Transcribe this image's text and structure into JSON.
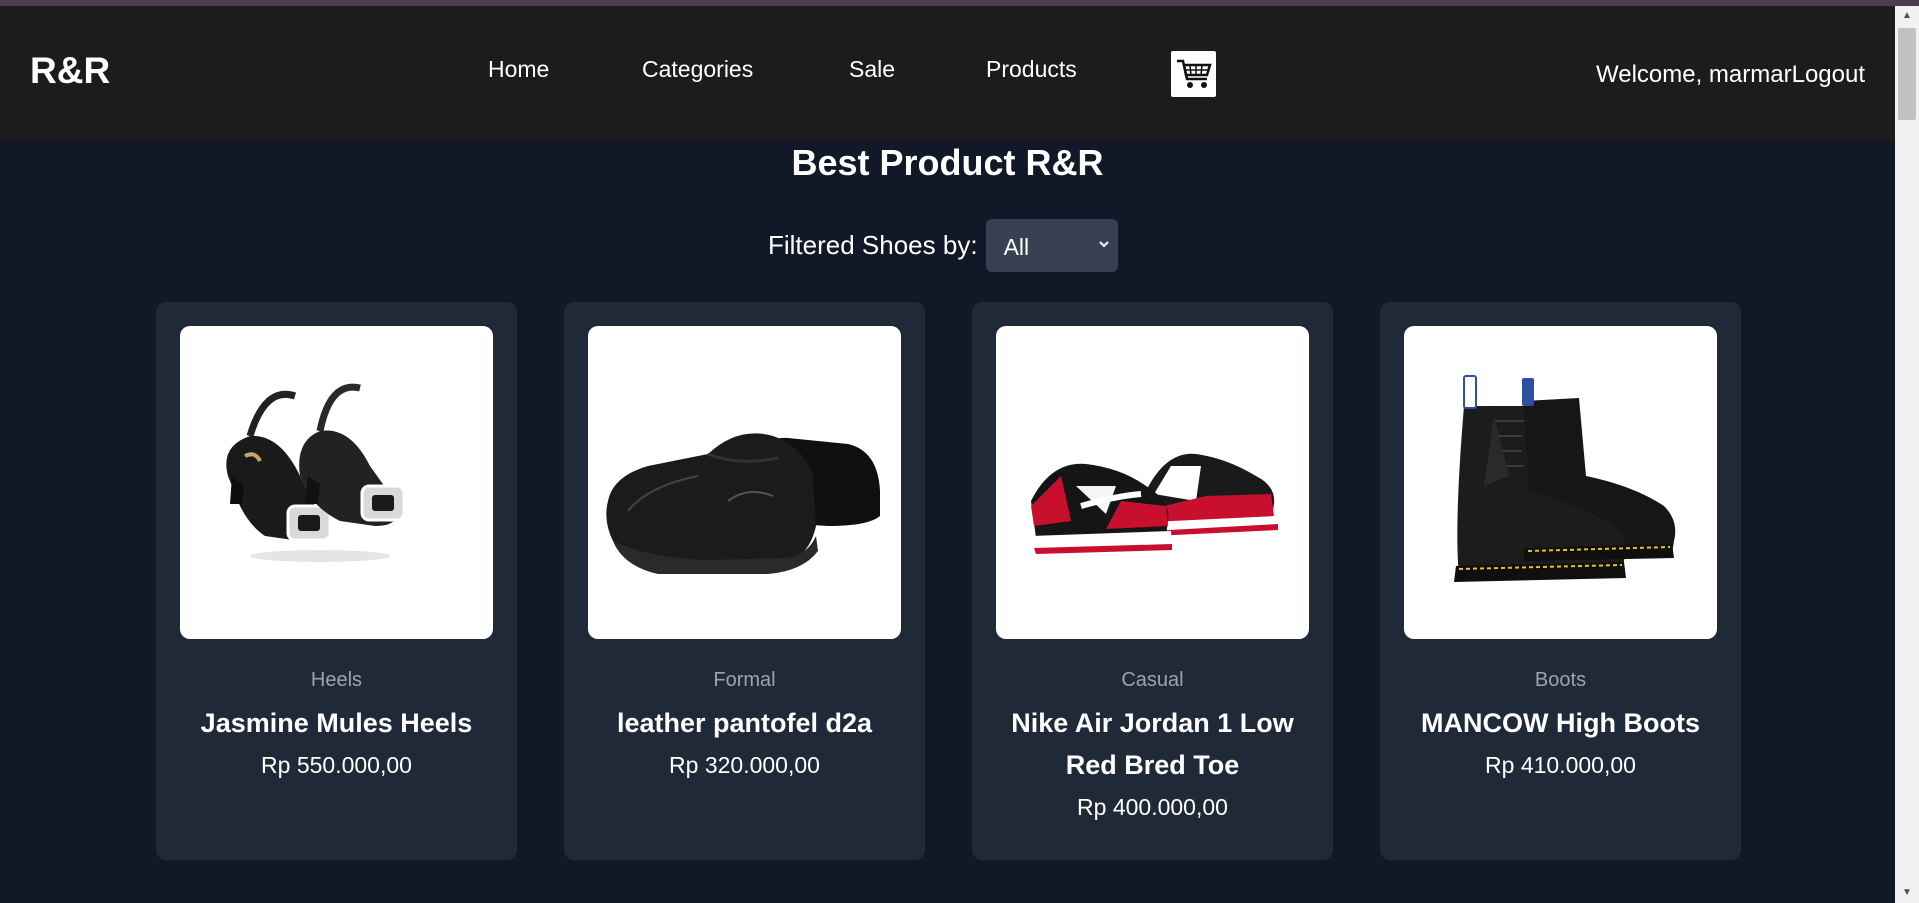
{
  "navbar": {
    "brand": "R&R",
    "links": [
      {
        "label": "Home"
      },
      {
        "label": "Categories"
      },
      {
        "label": "Sale"
      },
      {
        "label": "Products"
      }
    ],
    "cart_icon": "shopping-cart-icon",
    "welcome_text": "Welcome, marmar",
    "logout_label": "Logout"
  },
  "main": {
    "title": "Best Product R&R",
    "filter": {
      "label": "Filtered Shoes by:",
      "selected": "All"
    }
  },
  "products": [
    {
      "category": "Heels",
      "name": "Jasmine Mules Heels",
      "price": "Rp 550.000,00"
    },
    {
      "category": "Formal",
      "name": "leather pantofel d2a",
      "price": "Rp 320.000,00"
    },
    {
      "category": "Casual",
      "name": "Nike Air Jordan 1 Low Red Bred Toe",
      "price": "Rp 400.000,00"
    },
    {
      "category": "Boots",
      "name": "MANCOW High Boots",
      "price": "Rp 410.000,00"
    }
  ],
  "colors": {
    "navbar_bg": "#1c1c1c",
    "page_bg": "#111827",
    "card_bg": "#1f2937",
    "category_text": "#9ca3af"
  }
}
